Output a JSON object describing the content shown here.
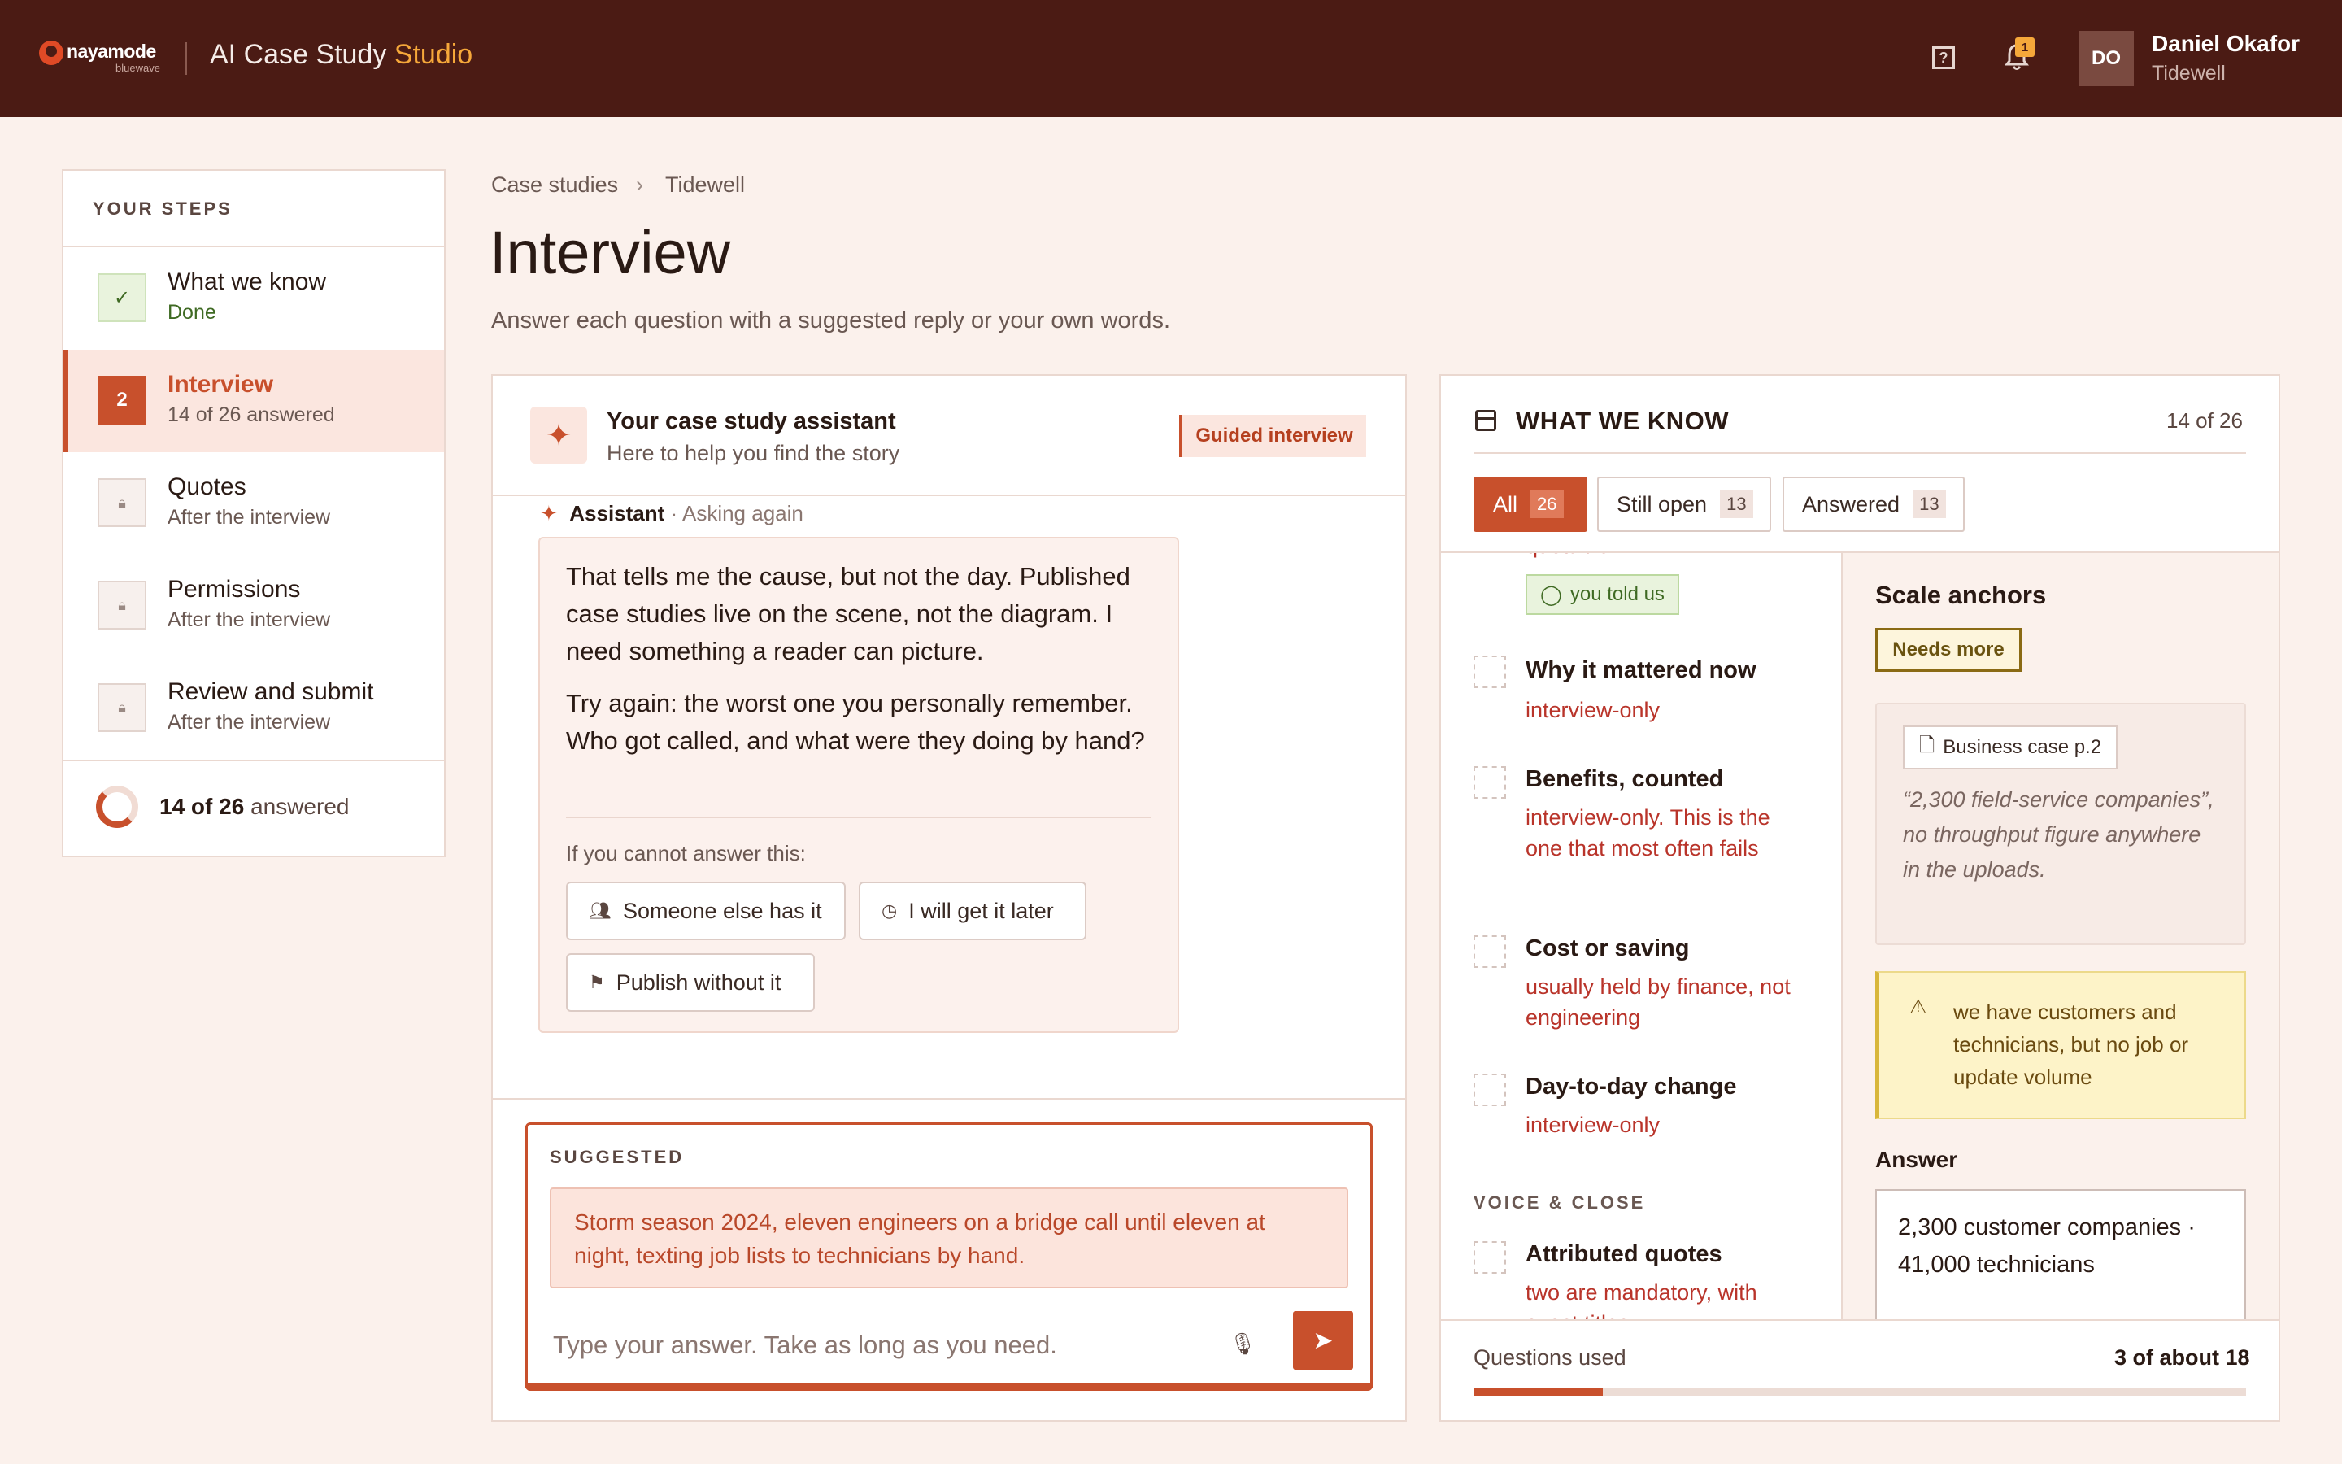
{
  "header": {
    "brand": "nayamode",
    "brand_sub": "bluewave",
    "app_title": "AI Case Study",
    "app_title_accent": "Studio",
    "notification_count": "1",
    "user_initials": "DO",
    "user_name": "Daniel Okafor",
    "user_org": "Tidewell"
  },
  "sidebar": {
    "heading": "YOUR STEPS",
    "steps": [
      {
        "title": "What we know",
        "sub": "Done",
        "marker": "✓"
      },
      {
        "title": "Interview",
        "sub": "14 of 26 answered",
        "marker": "2"
      },
      {
        "title": "Quotes",
        "sub": "After the interview"
      },
      {
        "title": "Permissions",
        "sub": "After the interview"
      },
      {
        "title": "Review and submit",
        "sub": "After the interview"
      }
    ],
    "progress_count": "14 of 26",
    "progress_suffix": "answered",
    "progress_fraction": 0.54
  },
  "breadcrumb": {
    "root": "Case studies",
    "current": "Tidewell"
  },
  "page": {
    "title": "Interview",
    "subtitle": "Answer each question with a suggested reply or your own words."
  },
  "assistant": {
    "title": "Your case study assistant",
    "subtitle": "Here to help you find the story",
    "mode_badge": "Guided interview",
    "sender": "Assistant",
    "sender_tag": "· Asking again",
    "paragraph1": "That tells me the cause, but not the day. Published case studies live on the scene, not the diagram. I need something a reader can picture.",
    "paragraph2": "Try again: the worst one you personally remember. Who got called, and what were they doing by hand?",
    "cannot_answer": "If you cannot answer this:",
    "options": [
      "Someone else has it",
      "I will get it later",
      "Publish without it"
    ]
  },
  "composer": {
    "suggested_label": "SUGGESTED",
    "suggested_text": "Storm season 2024, eleven engineers on a bridge call until eleven at night, texting job lists to technicians by hand.",
    "placeholder": "Type your answer. Take as long as you need."
  },
  "know": {
    "title": "WHAT WE KNOW",
    "count": "14 of 26",
    "filters": [
      {
        "label": "All",
        "count": "26"
      },
      {
        "label": "Still open",
        "count": "13"
      },
      {
        "label": "Answered",
        "count": "13"
      }
    ],
    "clipped_text": "quotable",
    "told_badge": "you told us",
    "items": [
      {
        "title": "Why it mattered now",
        "status": "interview-only"
      },
      {
        "title": "Benefits, counted",
        "status": "interview-only. This is the one that most often fails"
      },
      {
        "title": "Cost or saving",
        "status": "usually held by finance, not engineering"
      },
      {
        "title": "Day-to-day change",
        "status": "interview-only"
      }
    ],
    "section_voice": "VOICE & CLOSE",
    "voice_items": [
      {
        "title": "Attributed quotes",
        "status": "two are mandatory, with exact titles"
      }
    ],
    "detail": {
      "title": "Scale anchors",
      "status_badge": "Needs more",
      "source_tag": "Business case p.2",
      "source_quote": "“2,300 field-service companies”, no throughput figure anywhere in the uploads.",
      "warning": "we have customers and technicians, but no job or update volume",
      "answer_label": "Answer",
      "answer_value": "2,300 customer companies · 41,000 technicians"
    },
    "questions_used_label": "Questions used",
    "questions_used_value": "3 of about 18",
    "questions_used_fraction": 0.167
  },
  "colors": {
    "header_bg": "#4b1b14",
    "accent": "#c8502c",
    "studio_accent": "#f6a83a",
    "page_bg": "#fbf1ec",
    "warning_bg": "#fdf3c8",
    "done_green": "#3f6a23"
  },
  "icons": {
    "help": "help-circle-icon",
    "bell": "bell-icon",
    "lock": "lock-icon",
    "sparkle": "sparkle-icon",
    "mic": "mic-icon",
    "send": "send-icon",
    "users": "users-icon",
    "clock": "clock-icon",
    "flag": "flag-icon",
    "document": "document-icon",
    "warning": "warning-triangle-icon",
    "panel": "panel-icon",
    "chat": "chat-bubble-icon"
  }
}
